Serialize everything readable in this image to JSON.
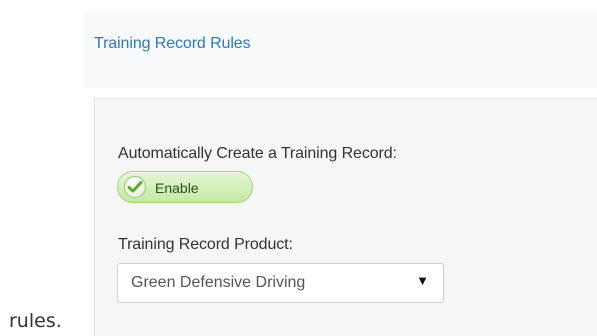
{
  "section": {
    "title": "Training Record Rules"
  },
  "auto_create": {
    "label": "Automatically Create a Training Record:",
    "toggle": {
      "icon": "check-circle-icon",
      "label": "Enable",
      "state": "enabled",
      "color": "#c4e9a5"
    }
  },
  "product": {
    "label": "Training Record Product:",
    "selected": "Green Defensive Driving",
    "arrow": "▼"
  },
  "trailing_text": "rules."
}
